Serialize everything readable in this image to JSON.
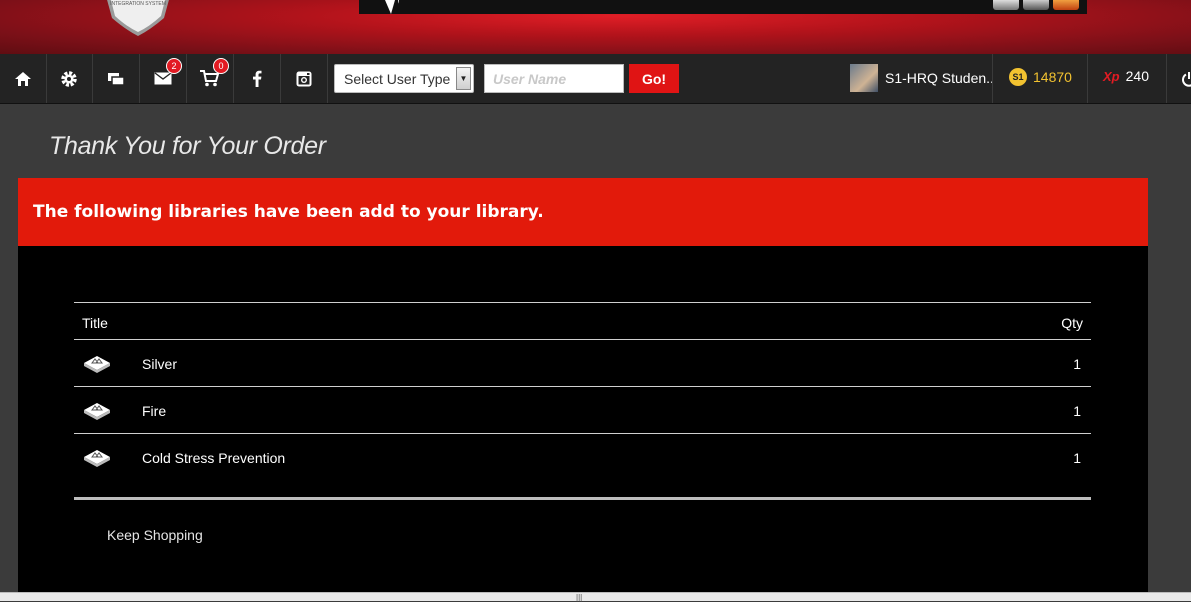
{
  "banner": {
    "logo_text": "INTEGRATION SYSTEM"
  },
  "nav": {
    "mail_badge": "2",
    "cart_badge": "0",
    "user_type_select": "Select User Type",
    "username_placeholder": "User Name",
    "go_label": "Go!",
    "user_name": "S1-HRQ Studen..",
    "s1_icon_text": "S1",
    "s1_points": "14870",
    "xp_icon_text": "Xp",
    "xp_points": "240",
    "colors": {
      "accent": "#e21a0b",
      "points": "#f2c230"
    },
    "icons": [
      "home-icon",
      "gear-icon",
      "chat-icon",
      "mail-icon",
      "cart-icon",
      "facebook-icon",
      "instagram-icon",
      "power-icon"
    ]
  },
  "page": {
    "title": "Thank You for Your Order",
    "alert": "The following libraries have been add to your library.",
    "table": {
      "headers": {
        "title": "Title",
        "qty": "Qty"
      },
      "rows": [
        {
          "title": "Silver",
          "qty": "1"
        },
        {
          "title": "Fire",
          "qty": "1"
        },
        {
          "title": "Cold Stress Prevention",
          "qty": "1"
        }
      ]
    },
    "keep_shopping": "Keep Shopping"
  }
}
